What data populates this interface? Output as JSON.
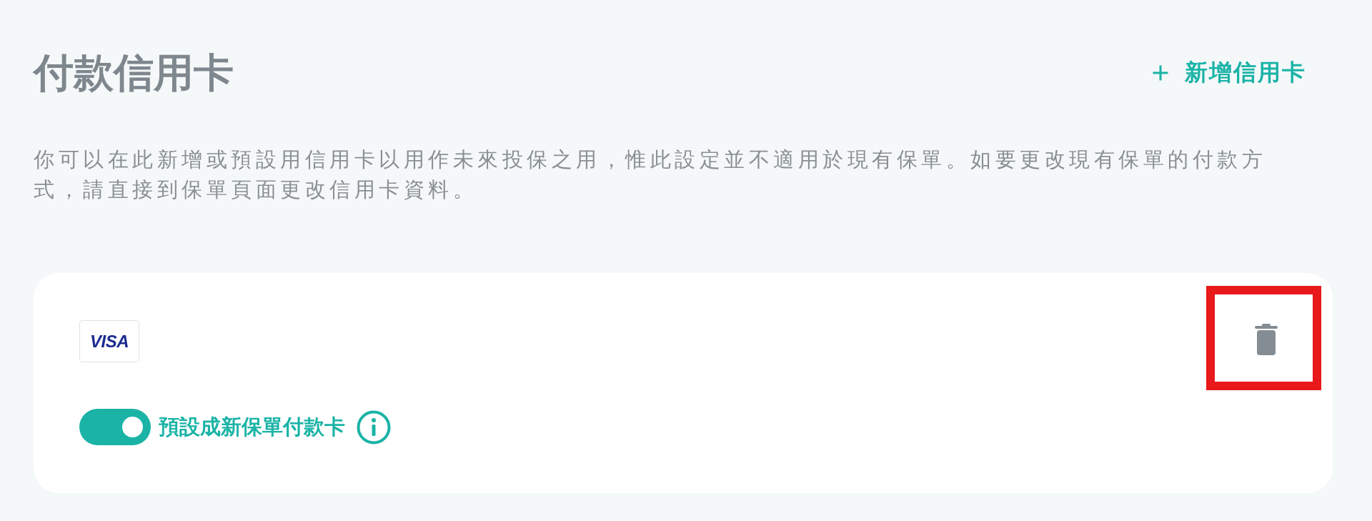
{
  "page": {
    "title": "付款信用卡",
    "add_button": {
      "label": "新增信用卡"
    },
    "description": "你可以在此新增或預設用信用卡以用作未來投保之用，惟此設定並不適用於現有保單。如要更改現有保單的付款方式，請直接到保單頁面更改信用卡資料。"
  },
  "cards": [
    {
      "brand": "VISA",
      "default_toggle": {
        "on": true,
        "label": "預設成新保單付款卡"
      }
    }
  ]
}
